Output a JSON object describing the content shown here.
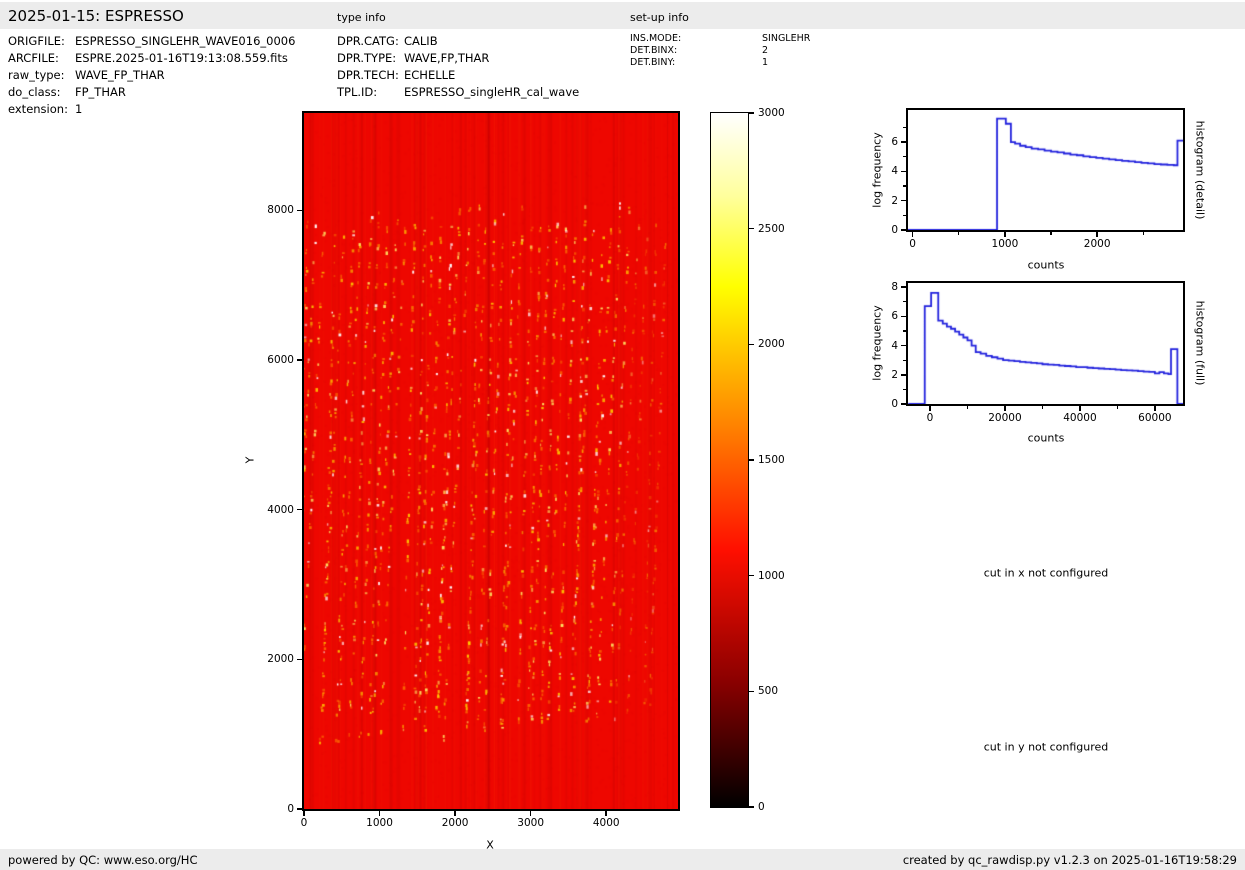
{
  "header": {
    "title": "2025-01-15: ESPRESSO",
    "type_info_label": "type info",
    "setup_info_label": "set-up info"
  },
  "file_info": {
    "rows": [
      {
        "label": "ORIGFILE:",
        "value": "ESPRESSO_SINGLEHR_WAVE016_0006"
      },
      {
        "label": "ARCFILE:",
        "value": "ESPRE.2025-01-16T19:13:08.559.fits"
      },
      {
        "label": "raw_type:",
        "value": "WAVE_FP_THAR"
      },
      {
        "label": "do_class:",
        "value": "FP_THAR"
      },
      {
        "label": "extension:",
        "value": "1"
      }
    ]
  },
  "type_info": {
    "rows": [
      {
        "label": "DPR.CATG:",
        "value": "CALIB"
      },
      {
        "label": "DPR.TYPE:",
        "value": "WAVE,FP,THAR"
      },
      {
        "label": "DPR.TECH:",
        "value": "ECHELLE"
      },
      {
        "label": "TPL.ID:",
        "value": "ESPRESSO_singleHR_cal_wave"
      }
    ]
  },
  "setup_info": {
    "rows": [
      {
        "label": "INS.MODE:",
        "value": "SINGLEHR"
      },
      {
        "label": "DET.BINX:",
        "value": "2"
      },
      {
        "label": "DET.BINY:",
        "value": "1"
      }
    ]
  },
  "messages": {
    "cut_x": "cut in x not configured",
    "cut_y": "cut in y not configured"
  },
  "footer": {
    "left": "powered by QC: www.eso.org/HC",
    "right": "created by qc_rawdisp.py v1.2.3 on 2025-01-16T19:58:29"
  },
  "chart_data": [
    {
      "type": "heatmap",
      "name": "raw-echelle-image",
      "xlabel": "X",
      "ylabel": "Y",
      "xlim": [
        0,
        4950
      ],
      "ylim": [
        0,
        9300
      ],
      "x_ticks": [
        0,
        1000,
        2000,
        3000,
        4000
      ],
      "y_ticks": [
        0,
        2000,
        4000,
        6000,
        8000
      ],
      "colormap": "hot",
      "background_level_counts": 1100,
      "background_color": "#ee0700",
      "bright_band_y_range": [
        1100,
        8200
      ],
      "n_order_columns": 41,
      "dot_colors": [
        "#ff7700",
        "#ffaa00",
        "#ffee44",
        "#ffffff"
      ],
      "colorbar": {
        "vmin": 0,
        "vmax": 3000,
        "ticks": [
          0,
          500,
          1000,
          1500,
          2000,
          2500,
          3000
        ],
        "gradient_stops": [
          {
            "at": 0.0,
            "color": "#000000"
          },
          {
            "at": 0.18,
            "color": "#8a0000"
          },
          {
            "at": 0.37,
            "color": "#ff0f00"
          },
          {
            "at": 0.55,
            "color": "#ff8300"
          },
          {
            "at": 0.75,
            "color": "#ffff00"
          },
          {
            "at": 0.88,
            "color": "#ffff9c"
          },
          {
            "at": 1.0,
            "color": "#ffffff"
          }
        ]
      }
    },
    {
      "type": "line",
      "name": "histogram-detail",
      "right_label": "histogram (detail)",
      "xlabel": "counts",
      "ylabel": "log frequency",
      "xlim": [
        -50,
        2930
      ],
      "ylim": [
        0,
        8.19
      ],
      "x_major_ticks": [
        0,
        1000,
        2000
      ],
      "x_minor_ticks": [
        500,
        1500,
        2500
      ],
      "y_major_ticks": [
        0,
        2,
        4,
        6
      ],
      "y_minor_ticks": [
        1,
        3,
        5,
        7
      ],
      "line_color": "#2222dd",
      "x_end": 2930,
      "steps": [
        [
          -50,
          0
        ],
        [
          915,
          7.6
        ],
        [
          1010,
          7.25
        ],
        [
          1065,
          6.0
        ],
        [
          1110,
          5.9
        ],
        [
          1165,
          5.75
        ],
        [
          1225,
          5.65
        ],
        [
          1290,
          5.55
        ],
        [
          1360,
          5.5
        ],
        [
          1430,
          5.42
        ],
        [
          1500,
          5.35
        ],
        [
          1570,
          5.3
        ],
        [
          1640,
          5.22
        ],
        [
          1710,
          5.15
        ],
        [
          1780,
          5.1
        ],
        [
          1850,
          5.02
        ],
        [
          1920,
          4.97
        ],
        [
          1990,
          4.92
        ],
        [
          2060,
          4.87
        ],
        [
          2130,
          4.82
        ],
        [
          2200,
          4.77
        ],
        [
          2270,
          4.72
        ],
        [
          2340,
          4.68
        ],
        [
          2410,
          4.63
        ],
        [
          2480,
          4.58
        ],
        [
          2550,
          4.55
        ],
        [
          2620,
          4.5
        ],
        [
          2690,
          4.47
        ],
        [
          2760,
          4.44
        ],
        [
          2830,
          4.42
        ],
        [
          2870,
          6.1
        ]
      ]
    },
    {
      "type": "line",
      "name": "histogram-full",
      "right_label": "histogram (full)",
      "xlabel": "counts",
      "ylabel": "log frequency",
      "xlim": [
        -5870,
        67500
      ],
      "ylim": [
        0,
        8.28
      ],
      "x_major_ticks": [
        0,
        20000,
        40000,
        60000
      ],
      "x_minor_ticks": [
        10000,
        30000,
        50000
      ],
      "y_major_ticks": [
        0,
        2,
        4,
        6,
        8
      ],
      "y_minor_ticks": [
        1,
        3,
        5,
        7
      ],
      "line_color": "#2222dd",
      "x_end": 67500,
      "steps": [
        [
          -5800,
          0
        ],
        [
          -1400,
          6.7
        ],
        [
          300,
          7.6
        ],
        [
          2200,
          5.7
        ],
        [
          3400,
          5.5
        ],
        [
          4500,
          5.3
        ],
        [
          5600,
          5.15
        ],
        [
          6700,
          4.95
        ],
        [
          7800,
          4.75
        ],
        [
          8900,
          4.55
        ],
        [
          10000,
          4.35
        ],
        [
          11100,
          4.0
        ],
        [
          12200,
          3.55
        ],
        [
          13500,
          3.45
        ],
        [
          15000,
          3.3
        ],
        [
          16500,
          3.2
        ],
        [
          18000,
          3.1
        ],
        [
          19500,
          3.0
        ],
        [
          21000,
          2.97
        ],
        [
          22500,
          2.93
        ],
        [
          24000,
          2.88
        ],
        [
          25500,
          2.85
        ],
        [
          27000,
          2.82
        ],
        [
          28500,
          2.78
        ],
        [
          30000,
          2.72
        ],
        [
          31500,
          2.7
        ],
        [
          33000,
          2.68
        ],
        [
          34500,
          2.62
        ],
        [
          36000,
          2.6
        ],
        [
          37500,
          2.57
        ],
        [
          39000,
          2.53
        ],
        [
          40500,
          2.52
        ],
        [
          42000,
          2.48
        ],
        [
          43500,
          2.45
        ],
        [
          45000,
          2.43
        ],
        [
          46500,
          2.4
        ],
        [
          48000,
          2.38
        ],
        [
          49500,
          2.35
        ],
        [
          51000,
          2.32
        ],
        [
          52500,
          2.3
        ],
        [
          54000,
          2.28
        ],
        [
          55500,
          2.25
        ],
        [
          57000,
          2.22
        ],
        [
          58500,
          2.2
        ],
        [
          60000,
          2.1
        ],
        [
          61200,
          2.18
        ],
        [
          62400,
          2.1
        ],
        [
          63600,
          2.05
        ],
        [
          64300,
          3.75
        ],
        [
          66000,
          0
        ]
      ]
    }
  ]
}
